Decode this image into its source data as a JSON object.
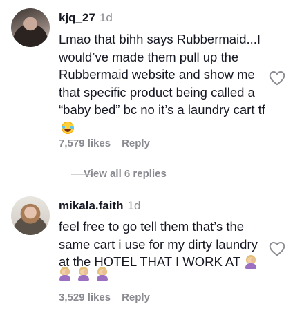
{
  "comments": [
    {
      "username": "kjq_27",
      "time": "1d",
      "text": "Lmao that bihh says Rubbermaid...I would’ve made them pull up the Rubbermaid website and show me that specific product being called a “baby bed” bc no it’s a laundry cart tf",
      "emoji": "face-with-tears-of-joy-emoji",
      "likes": "7,579 likes",
      "reply_label": "Reply"
    },
    {
      "username": "mikala.faith",
      "time": "1d",
      "text": "feel free to go tell them that’s the same cart i use for my dirty laundry at the HOTEL THAT I WORK AT",
      "emoji": "woman-facepalming-emoji",
      "likes": "3,529 likes",
      "reply_label": "Reply"
    }
  ],
  "view_replies_label": "View all 6 replies",
  "icons": {
    "like": "heart-outline-icon"
  }
}
